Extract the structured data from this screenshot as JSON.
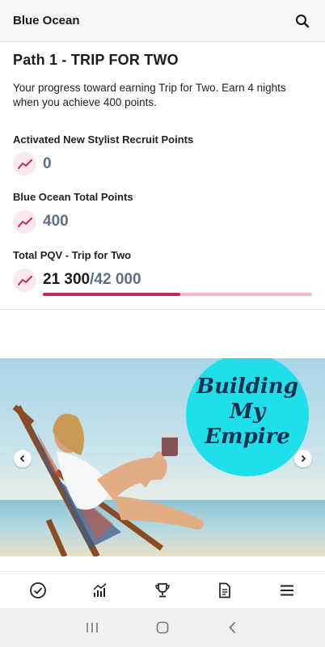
{
  "app": {
    "title": "Blue Ocean"
  },
  "path": {
    "title": "Path 1 - TRIP FOR TWO",
    "description": "Your progress toward earning Trip for Two. Earn 4 nights when you achieve 400 points."
  },
  "metrics": [
    {
      "label": "Activated New Stylist Recruit Points",
      "value": "0",
      "icon": "trend-up-icon"
    },
    {
      "label": "Blue Ocean Total Points",
      "value": "400",
      "icon": "trend-up-icon"
    },
    {
      "label": "Total PQV - Trip for Two",
      "current": "21 300",
      "target": "/42 000",
      "icon": "trend-up-icon",
      "progress": 0.51
    }
  ],
  "banner": {
    "badge_lines": [
      "Building",
      "My",
      "Empire"
    ],
    "badge_color": "#1fe0ea"
  },
  "tabbar": {
    "items": [
      {
        "name": "check-circle-icon"
      },
      {
        "name": "bar-chart-icon"
      },
      {
        "name": "trophy-icon"
      },
      {
        "name": "document-icon"
      },
      {
        "name": "menu-icon"
      }
    ]
  },
  "colors": {
    "accent": "#c0275a",
    "accent_light": "#f2b8c8",
    "value_gray": "#5f6f86"
  }
}
